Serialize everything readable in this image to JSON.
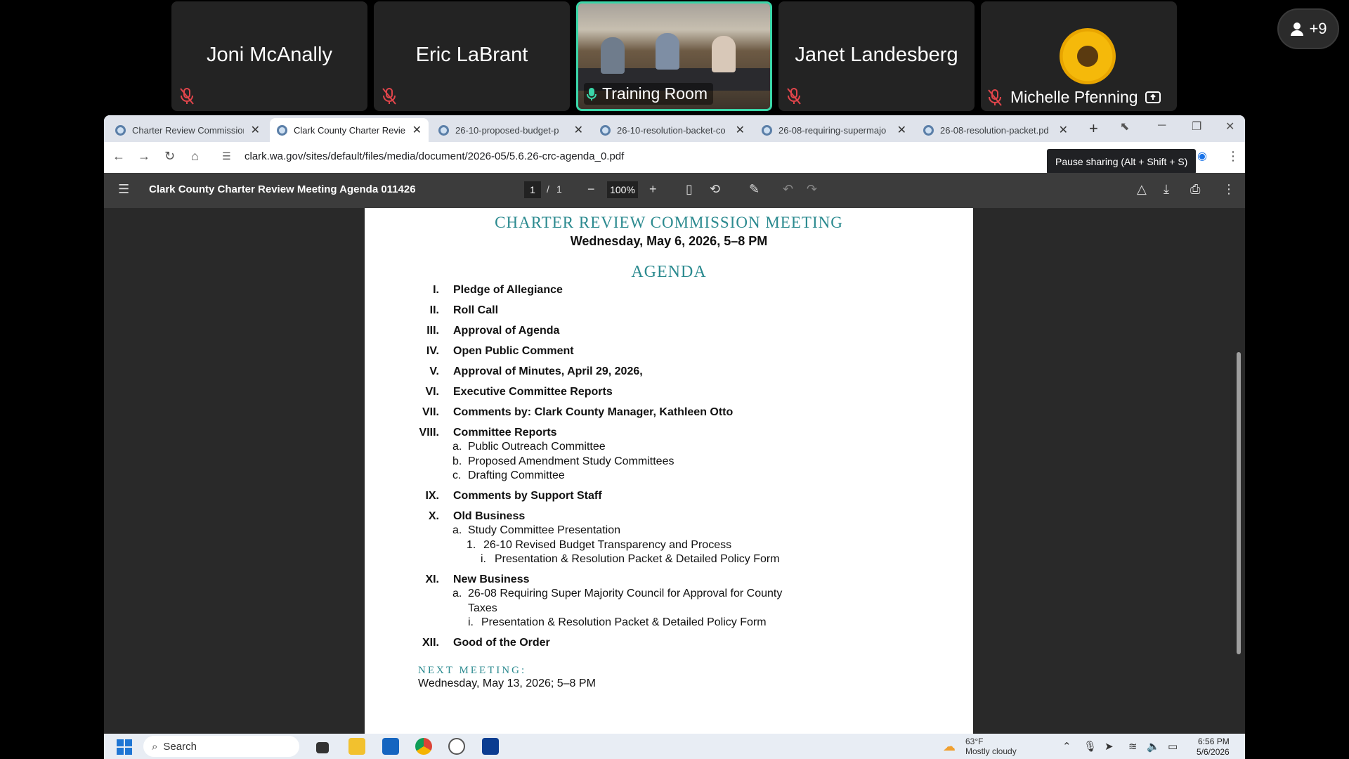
{
  "participants": [
    {
      "name": "Joni McAnally"
    },
    {
      "name": "Eric LaBrant"
    },
    {
      "name": "Training Room"
    },
    {
      "name": "Janet Landesberg"
    },
    {
      "name": "Michelle Pfenning"
    }
  ],
  "overflow_count": "+9",
  "browser": {
    "tabs": [
      {
        "title": "Charter Review Commission"
      },
      {
        "title": "Clark County Charter Review"
      },
      {
        "title": "26-10-proposed-budget-p"
      },
      {
        "title": "26-10-resolution-backet-co"
      },
      {
        "title": "26-08-requiring-supermajo"
      },
      {
        "title": "26-08-resolution-packet.pd"
      }
    ],
    "url": "clark.wa.gov/sites/default/files/media/document/2026-05/5.6.26-crc-agenda_0.pdf",
    "tooltip": "Pause sharing (Alt + Shift + S)"
  },
  "pdf": {
    "title": "Clark County Charter Review Meeting Agenda 011426",
    "page_current": "1",
    "page_sep": "/",
    "page_total": "1",
    "zoom": "100%"
  },
  "doc": {
    "heading": "CHARTER REVIEW COMMISSION MEETING",
    "date": "Wednesday, May 6, 2026, 5–8 PM",
    "agenda_title": "AGENDA",
    "items": [
      {
        "num": "I.",
        "label": "Pledge of Allegiance"
      },
      {
        "num": "II.",
        "label": "Roll Call"
      },
      {
        "num": "III.",
        "label": "Approval of Agenda"
      },
      {
        "num": "IV.",
        "label": "Open Public Comment"
      },
      {
        "num": "V.",
        "label": "Approval of Minutes, April 29, 2026,"
      },
      {
        "num": "VI.",
        "label": "Executive Committee Reports"
      },
      {
        "num": "VII.",
        "label": "Comments by: Clark County Manager, Kathleen Otto"
      },
      {
        "num": "VIII.",
        "label": "Committee Reports"
      },
      {
        "num": "IX.",
        "label": "Comments by Support Staff"
      },
      {
        "num": "X.",
        "label": "Old Business"
      },
      {
        "num": "XI.",
        "label": "New Business"
      },
      {
        "num": "XII.",
        "label": "Good of the Order"
      }
    ],
    "committee_subs": [
      {
        "marker": "a.",
        "text": "Public Outreach Committee"
      },
      {
        "marker": "b.",
        "text": "Proposed Amendment Study Committees"
      },
      {
        "marker": "c.",
        "text": "Drafting Committee"
      }
    ],
    "old_business_subs": [
      {
        "marker": "a.",
        "text": "Study Committee Presentation"
      },
      {
        "marker": "1.",
        "text": "26-10 Revised Budget Transparency and Process"
      },
      {
        "marker": "i.",
        "text": "Presentation & Resolution Packet & Detailed Policy Form"
      }
    ],
    "new_business_subs": [
      {
        "marker": "a.",
        "text": "26-08 Requiring Super Majority Council for Approval for County"
      },
      {
        "marker": "",
        "text": "Taxes"
      },
      {
        "marker": "i.",
        "text": "Presentation & Resolution Packet & Detailed Policy Form"
      }
    ],
    "next_meeting_label": "NEXT MEETING:",
    "next_meeting_date": "Wednesday, May 13, 2026; 5–8 PM"
  },
  "taskbar": {
    "search_label": "Search",
    "temp": "63°F",
    "condition": "Mostly cloudy",
    "time": "6:56 PM",
    "date": "5/6/2026"
  },
  "colors": {
    "accent_teal": "#2b8a8f",
    "active_speaker": "#3ad6a8",
    "pdf_toolbar": "#3c3c3c"
  }
}
